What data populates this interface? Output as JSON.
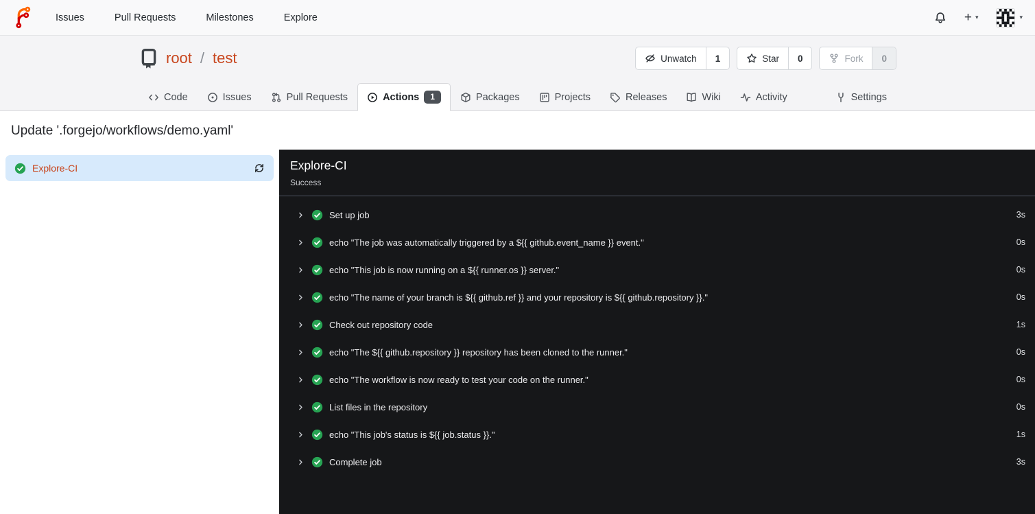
{
  "colors": {
    "accent_link": "#c8461e",
    "success_green": "#27a353",
    "selected_job_bg": "#d7eafc",
    "panel_bg": "#161719",
    "badge_bg": "#4c5157"
  },
  "navbar": {
    "logo_icon": "forgejo-logo-icon",
    "links": [
      "Issues",
      "Pull Requests",
      "Milestones",
      "Explore"
    ],
    "right_icons": [
      "bell-icon",
      "plus-icon",
      "caret-down-icon",
      "user-avatar",
      "caret-down-icon"
    ],
    "plus_glyph": "+",
    "caret_glyph": "▾"
  },
  "repo_header": {
    "icon": "repo-icon",
    "owner": "root",
    "separator": "/",
    "name": "test",
    "buttons": [
      {
        "icon": "eye-slash-icon",
        "label": "Unwatch",
        "count": "1"
      },
      {
        "icon": "star-icon",
        "label": "Star",
        "count": "0"
      },
      {
        "icon": "fork-icon",
        "label": "Fork",
        "count": "0"
      }
    ]
  },
  "tabs": [
    {
      "label": "Code",
      "icon": "code-icon"
    },
    {
      "label": "Issues",
      "icon": "issue-opened-icon"
    },
    {
      "label": "Pull Requests",
      "icon": "git-pull-request-icon"
    },
    {
      "label": "Actions",
      "icon": "play-circle-icon",
      "badge": "1"
    },
    {
      "label": "Packages",
      "icon": "package-icon"
    },
    {
      "label": "Projects",
      "icon": "project-icon"
    },
    {
      "label": "Releases",
      "icon": "tag-icon"
    },
    {
      "label": "Wiki",
      "icon": "book-icon"
    },
    {
      "label": "Activity",
      "icon": "pulse-icon"
    },
    {
      "label": "Settings",
      "icon": "tools-icon"
    }
  ],
  "run": {
    "title": "Update '.forgejo/workflows/demo.yaml'"
  },
  "jobs_sidebar": {
    "items": [
      {
        "name": "Explore-CI",
        "status_icon": "check-circle-icon",
        "action_icon": "refresh-icon"
      }
    ]
  },
  "job_panel": {
    "title": "Explore-CI",
    "status": "Success",
    "steps": [
      {
        "name": "Set up job",
        "duration": "3s"
      },
      {
        "name": "echo \"The job was automatically triggered by a ${{ github.event_name }} event.\"",
        "duration": "0s"
      },
      {
        "name": "echo \"This job is now running on a ${{ runner.os }} server.\"",
        "duration": "0s"
      },
      {
        "name": "echo \"The name of your branch is ${{ github.ref }} and your repository is ${{ github.repository }}.\"",
        "duration": "0s"
      },
      {
        "name": "Check out repository code",
        "duration": "1s"
      },
      {
        "name": "echo \"The ${{ github.repository }} repository has been cloned to the runner.\"",
        "duration": "0s"
      },
      {
        "name": "echo \"The workflow is now ready to test your code on the runner.\"",
        "duration": "0s"
      },
      {
        "name": "List files in the repository",
        "duration": "0s"
      },
      {
        "name": "echo \"This job's status is ${{ job.status }}.\"",
        "duration": "1s"
      },
      {
        "name": "Complete job",
        "duration": "3s"
      }
    ]
  }
}
